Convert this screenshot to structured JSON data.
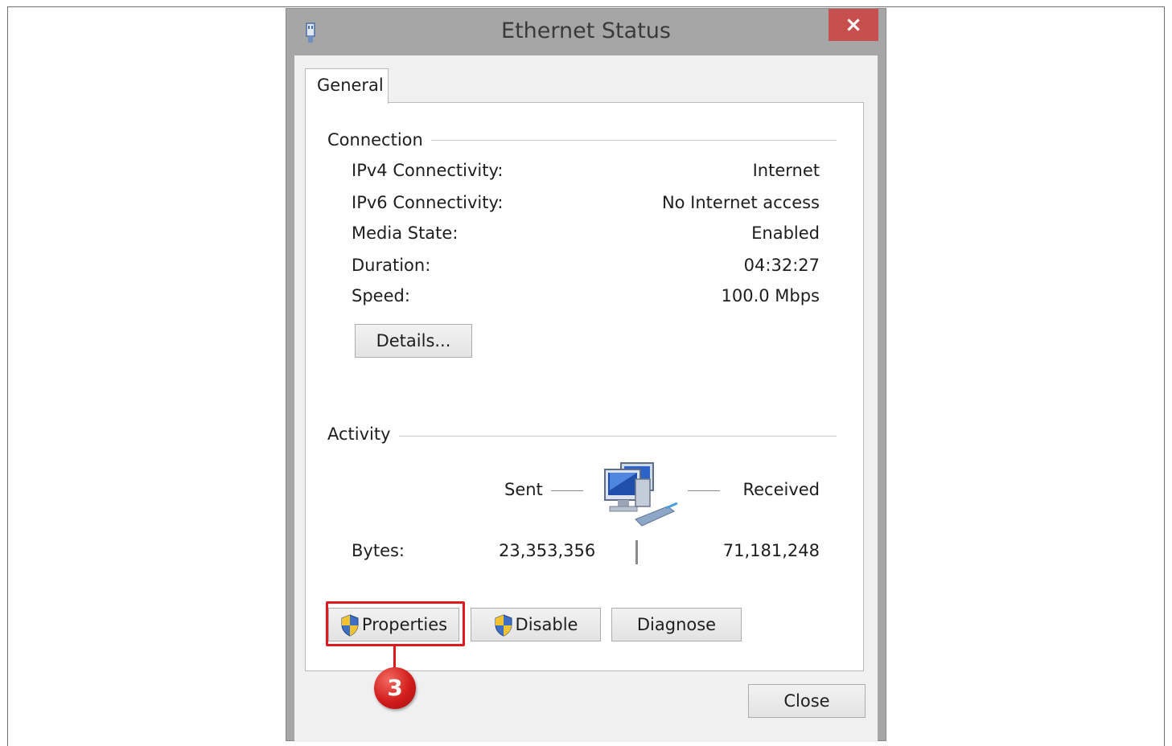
{
  "window": {
    "title": "Ethernet Status",
    "close_glyph": "×"
  },
  "tabs": [
    {
      "label": "General",
      "selected": true
    }
  ],
  "connection": {
    "heading": "Connection",
    "rows": [
      {
        "label": "IPv4 Connectivity:",
        "value": "Internet"
      },
      {
        "label": "IPv6 Connectivity:",
        "value": "No Internet access"
      },
      {
        "label": "Media State:",
        "value": "Enabled"
      },
      {
        "label": "Duration:",
        "value": "04:32:27"
      },
      {
        "label": "Speed:",
        "value": "100.0 Mbps"
      }
    ],
    "details_button": "Details..."
  },
  "activity": {
    "heading": "Activity",
    "sent_label": "Sent",
    "received_label": "Received",
    "bytes_label": "Bytes:",
    "bytes_sent": "23,353,356",
    "bytes_received": "71,181,248"
  },
  "buttons": {
    "properties": "Properties",
    "disable": "Disable",
    "diagnose": "Diagnose",
    "close": "Close"
  },
  "annotation": {
    "step_number": "3",
    "highlight_color": "#e0191d"
  },
  "icons": {
    "titlebar": "network-adapter-icon",
    "activity": "network-computers-icon",
    "uac": "uac-shield-icon"
  }
}
